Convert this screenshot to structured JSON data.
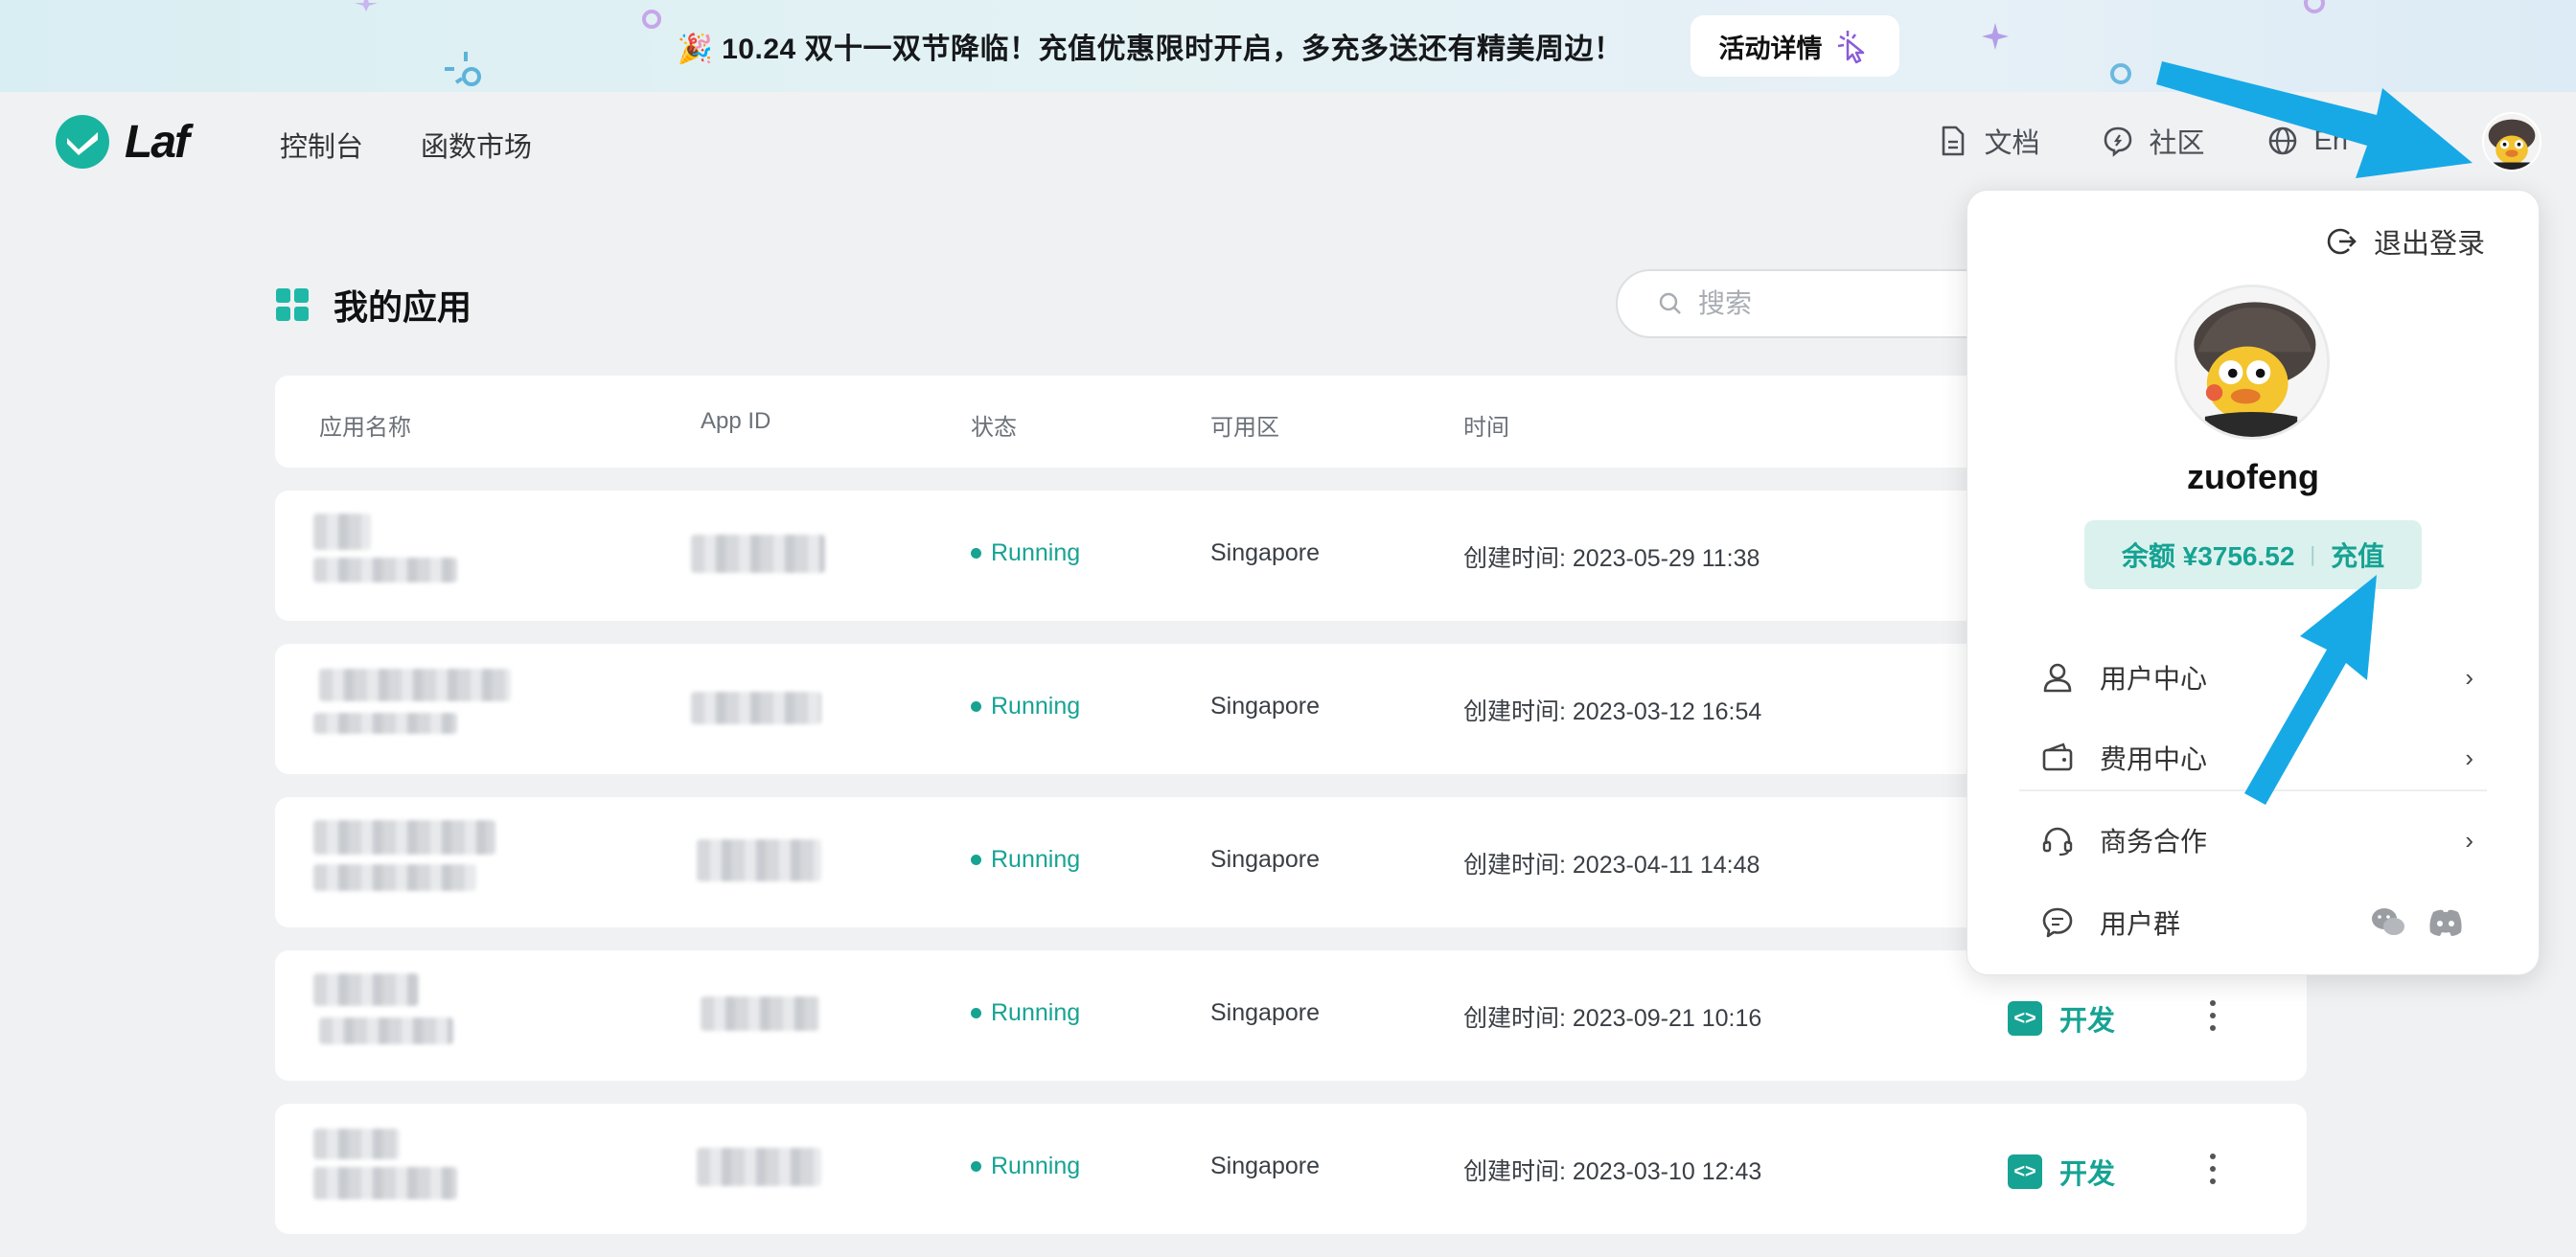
{
  "banner": {
    "text": "🎉 10.24 双十一双节降临！充值优惠限时开启，多充多送还有精美周边！",
    "button_label": "活动详情"
  },
  "header": {
    "logo_text": "Laf",
    "nav": [
      "控制台",
      "函数市场"
    ],
    "docs_label": "文档",
    "community_label": "社区",
    "lang_label": "En"
  },
  "main": {
    "title": "我的应用",
    "search_placeholder": "搜索",
    "columns": [
      "应用名称",
      "App ID",
      "状态",
      "可用区",
      "时间"
    ],
    "rows": [
      {
        "status": "Running",
        "region": "Singapore",
        "time": "创建时间: 2023-05-29 11:38"
      },
      {
        "status": "Running",
        "region": "Singapore",
        "time": "创建时间: 2023-03-12 16:54"
      },
      {
        "status": "Running",
        "region": "Singapore",
        "time": "创建时间: 2023-04-11 14:48"
      },
      {
        "status": "Running",
        "region": "Singapore",
        "time": "创建时间: 2023-09-21 10:16",
        "action": "开发"
      },
      {
        "status": "Running",
        "region": "Singapore",
        "time": "创建时间: 2023-03-10 12:43",
        "action": "开发"
      }
    ]
  },
  "dropdown": {
    "logout_label": "退出登录",
    "username": "zuofeng",
    "balance_label": "余额 ¥3756.52",
    "separator": "|",
    "recharge_label": "充值",
    "menu": [
      {
        "label": "用户中心",
        "icon": "user-icon"
      },
      {
        "label": "费用中心",
        "icon": "wallet-icon"
      },
      {
        "label": "商务合作",
        "icon": "headset-icon"
      },
      {
        "label": "用户群",
        "icon": "chat-icon"
      }
    ],
    "chevron": "›"
  },
  "colors": {
    "accent": "#16a393",
    "arrow": "#17a9e6",
    "balance_bg": "#dbf1ee"
  }
}
